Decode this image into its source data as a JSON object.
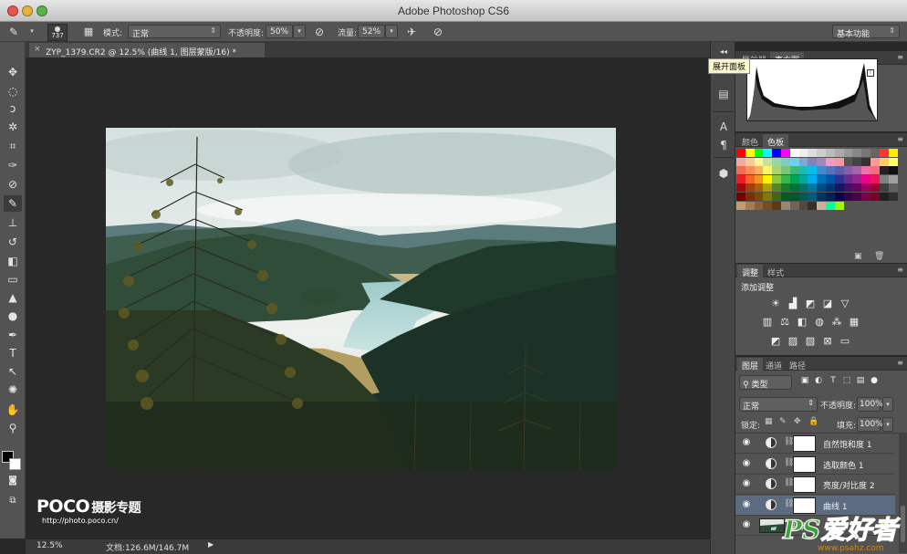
{
  "window": {
    "title": "Adobe Photoshop CS6"
  },
  "options_bar": {
    "brush_size": "737",
    "mode_label": "模式:",
    "mode_value": "正常",
    "opacity_label": "不透明度:",
    "opacity_value": "50%",
    "flow_label": "流量:",
    "flow_value": "52%",
    "workspace": "基本功能"
  },
  "document": {
    "tab_title": "ZYP_1379.CR2 @ 12.5% (曲线 1, 图层蒙版/16) *",
    "close_glyph": "×"
  },
  "status_bar": {
    "zoom": "12.5%",
    "doc_size": "文档:126.6M/146.7M",
    "play_glyph": "▶"
  },
  "tooltip": "展开面板",
  "histogram_panel": {
    "tabs": [
      "导航器",
      "直方图"
    ],
    "active": 1
  },
  "swatches_panel": {
    "tabs": [
      "颜色",
      "色板"
    ],
    "active": 1
  },
  "adjustments_panel": {
    "tabs": [
      "调整",
      "样式"
    ],
    "active": 0,
    "title": "添加调整"
  },
  "layers_panel": {
    "tabs": [
      "图层",
      "通道",
      "路径"
    ],
    "active": 0,
    "filter_kind": "类型",
    "blend_mode": "正常",
    "opacity_label": "不透明度:",
    "opacity_value": "100%",
    "lock_label": "锁定:",
    "fill_label": "填充:",
    "fill_value": "100%",
    "layers": [
      {
        "name": "自然饱和度 1",
        "selected": false
      },
      {
        "name": "选取颜色 1",
        "selected": false
      },
      {
        "name": "亮度/对比度 2",
        "selected": false
      },
      {
        "name": "曲线 1",
        "selected": true
      },
      {
        "name": "背景",
        "selected": false
      }
    ]
  },
  "watermark": {
    "poco": "POCO",
    "poco_sub": "摄影专题",
    "poco_url": "http://photo.poco.cn/",
    "ps_text": "PS爱好者",
    "ps_url": "www.psahz.com"
  },
  "colors": {
    "chrome": "#535353",
    "canvas_bg": "#282828",
    "selected_layer": "#5d6b80",
    "ps_logo_green": "#3aa13a",
    "ps_logo_gold": "#c98a18"
  },
  "swatch_colors": [
    [
      "#ff0000",
      "#ffff00",
      "#00ff00",
      "#00ffff",
      "#0000ff",
      "#ff00ff",
      "#ffffff",
      "#eeeeee",
      "#dddddd",
      "#cccccc",
      "#bbbbbb",
      "#aaaaaa",
      "#999999",
      "#888888",
      "#777777",
      "#666666",
      "#ff3333",
      "#ffee00"
    ],
    [
      "#f7a99e",
      "#f9c996",
      "#fff79a",
      "#c6e19a",
      "#9cd7a3",
      "#7fcdc0",
      "#6dcff6",
      "#7da7d9",
      "#8781bd",
      "#a186be",
      "#f49ac1",
      "#f6989d",
      "#555555",
      "#444444",
      "#333333",
      "#ff9999",
      "#ffcc66",
      "#ffff66"
    ],
    [
      "#f26c4f",
      "#f68e55",
      "#fbaf5c",
      "#fff467",
      "#acd372",
      "#7cc576",
      "#3bb878",
      "#1abbb4",
      "#00bff3",
      "#438ccb",
      "#5574b9",
      "#605ca8",
      "#855fa8",
      "#a763a8",
      "#f06ea9",
      "#f26d7d",
      "#222222",
      "#111111"
    ],
    [
      "#ed1c24",
      "#f26522",
      "#f7941d",
      "#fff200",
      "#8dc63f",
      "#39b54a",
      "#00a651",
      "#00a99d",
      "#00aeef",
      "#0072bc",
      "#0054a6",
      "#2e3192",
      "#662d91",
      "#92278f",
      "#ec008c",
      "#ed145b",
      "#808080",
      "#a0a0a0"
    ],
    [
      "#9e0b0f",
      "#a0410d",
      "#a3620a",
      "#aba000",
      "#598527",
      "#1a7b30",
      "#007236",
      "#00746b",
      "#0076a3",
      "#004b80",
      "#003471",
      "#1b1464",
      "#440e62",
      "#630460",
      "#9e005d",
      "#9e0039",
      "#404040",
      "#606060"
    ],
    [
      "#790000",
      "#7b2e00",
      "#7d4900",
      "#827b00",
      "#406618",
      "#005e20",
      "#005826",
      "#005952",
      "#005b7f",
      "#003663",
      "#002157",
      "#0d004c",
      "#32004b",
      "#4b0049",
      "#7b0046",
      "#7a0026",
      "#202020",
      "#303030"
    ],
    [
      "#c69c6d",
      "#a67c52",
      "#8c6239",
      "#754c24",
      "#603913",
      "#998675",
      "#736357",
      "#534741",
      "#362f2d",
      "#c7b299",
      "#00ff99",
      "#99ff00"
    ]
  ]
}
